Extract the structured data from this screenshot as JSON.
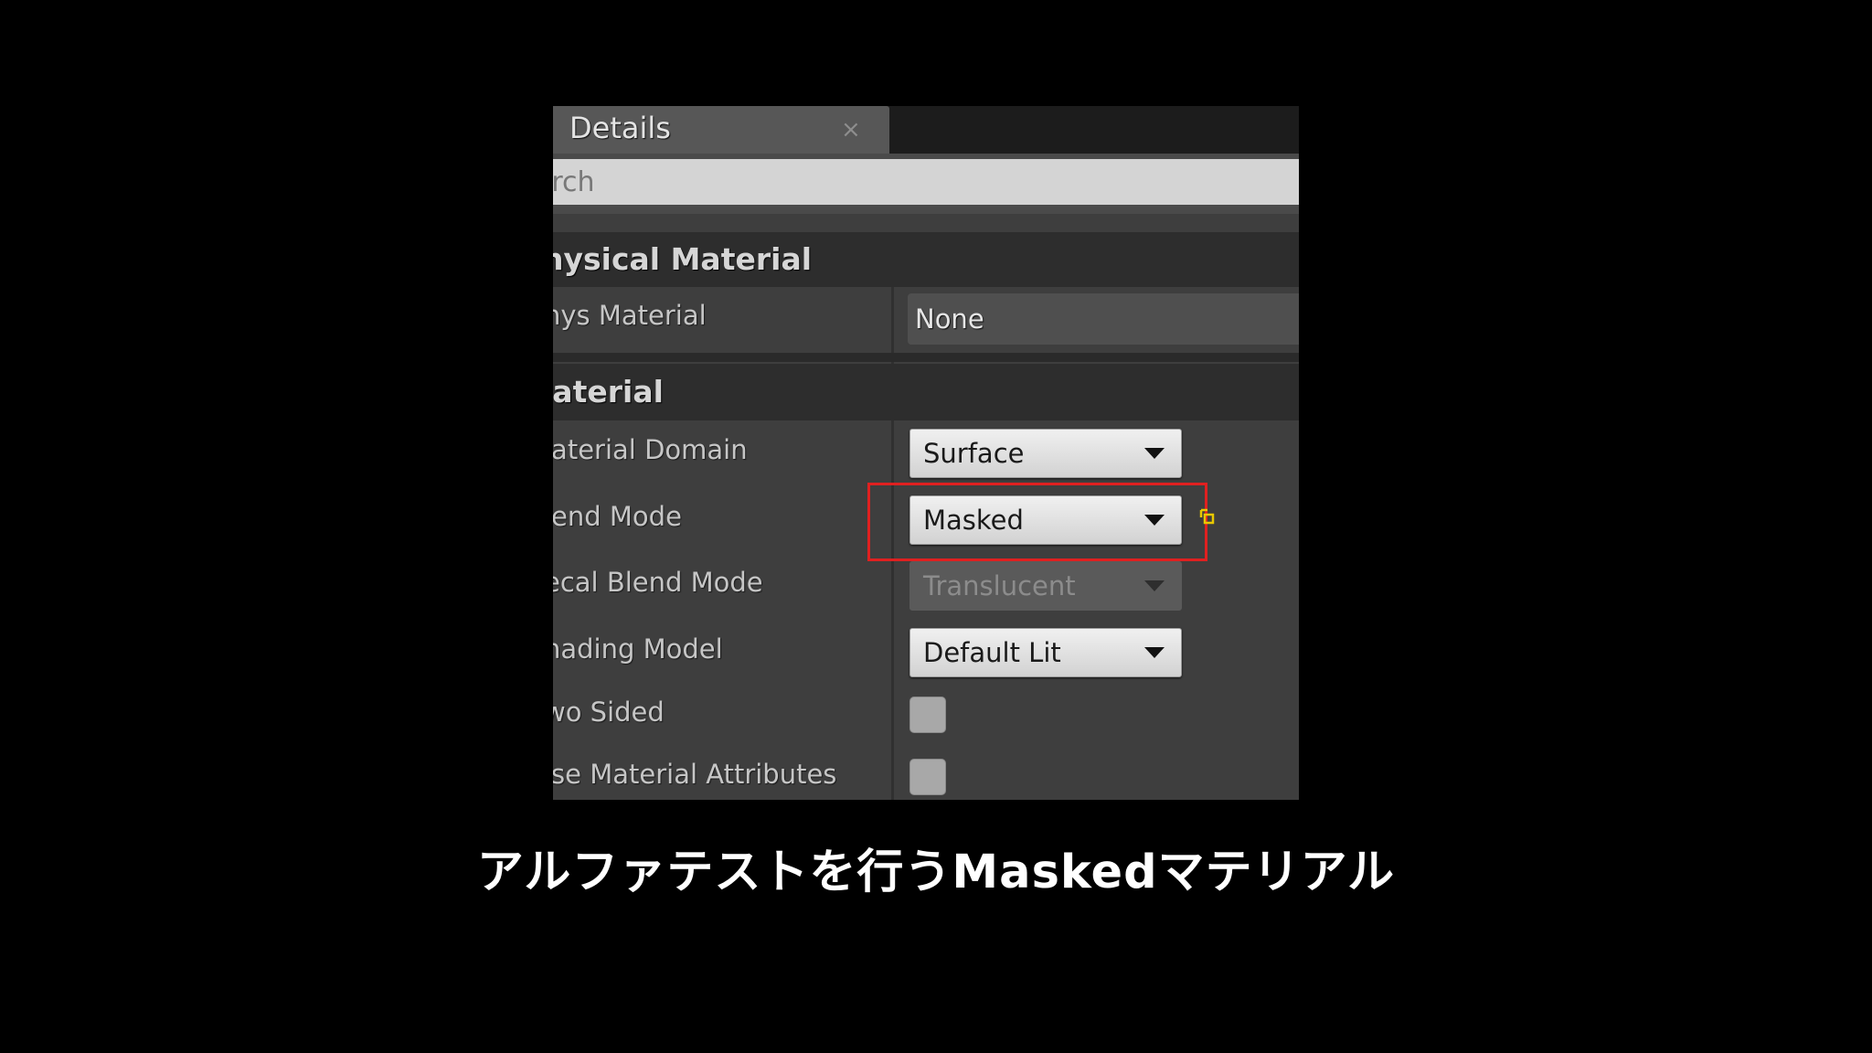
{
  "panel": {
    "tab_title": "Details",
    "tab_close_glyph": "×",
    "search_placeholder": "arch",
    "categories": [
      {
        "label": "hysical Material",
        "rows": [
          {
            "label": "hys Material",
            "value": "None"
          }
        ]
      },
      {
        "label": "laterial",
        "rows": [
          {
            "label": "laterial Domain",
            "value": "Surface",
            "control": "dropdown"
          },
          {
            "label": "lend Mode",
            "value": "Masked",
            "control": "dropdown",
            "highlighted": true
          },
          {
            "label": "ecal Blend Mode",
            "value": "Translucent",
            "control": "dropdown",
            "disabled": true
          },
          {
            "label": "hading Model",
            "value": "Default Lit",
            "control": "dropdown"
          },
          {
            "label": "wo Sided",
            "control": "checkbox",
            "checked": false
          },
          {
            "label": "lse Material Attributes",
            "control": "checkbox",
            "checked": false
          }
        ]
      }
    ]
  },
  "caption": "アルファテストを行うMaskedマテリアル",
  "colors": {
    "background": "#000000",
    "panel": "#3e3e3e",
    "highlight_box": "#e02020",
    "caption": "#ffffff"
  }
}
